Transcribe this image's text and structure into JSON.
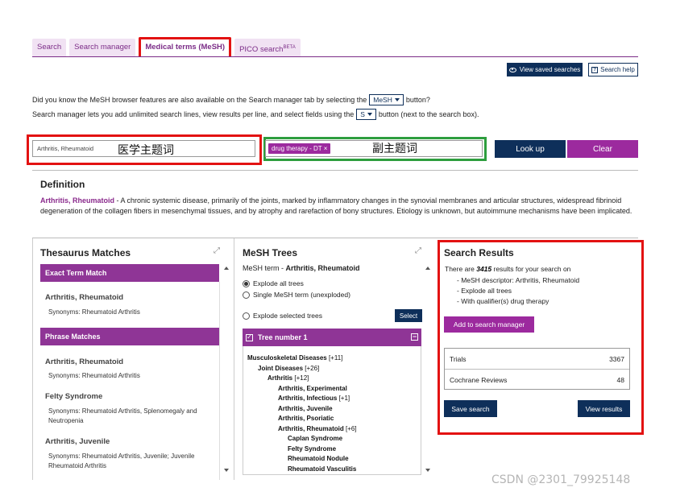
{
  "tabs": [
    {
      "label": "Search",
      "active": false
    },
    {
      "label": "Search manager",
      "active": false
    },
    {
      "label": "Medical terms (MeSH)",
      "active": true
    },
    {
      "label": "PICO search",
      "sup": "BETA",
      "active": false
    }
  ],
  "top_buttons": {
    "view_saved": "View saved searches",
    "search_help": "Search help"
  },
  "info": {
    "line1_pre": "Did you know the MeSH browser features are also available on the Search manager tab by selecting the",
    "line1_btn": "MeSH",
    "line1_post": "button?",
    "line2_pre": "Search manager lets you add unlimited search lines, view results per line, and select fields using the",
    "line2_btn": "S",
    "line2_post": "button (next to the search box)."
  },
  "search": {
    "main_term_value": "Arthritis, Rheumatoid",
    "main_term_annotation": "医学主题词",
    "qualifier_chip": "drug therapy - DT",
    "qualifier_chip_remove": "×",
    "qualifier_annotation": "副主题词",
    "lookup_label": "Look up",
    "clear_label": "Clear"
  },
  "definition": {
    "heading": "Definition",
    "term": "Arthritis, Rheumatoid",
    "text": " - A chronic systemic disease, primarily of the joints, marked by inflammatory changes in the synovial membranes and articular structures, widespread fibrinoid degeneration of the collagen fibers in mesenchymal tissues, and by atrophy and rarefaction of bony structures. Etiology is unknown, but autoimmune mechanisms have been implicated."
  },
  "thesaurus": {
    "title": "Thesaurus Matches",
    "exact_header": "Exact Term Match",
    "exact_items": [
      {
        "term": "Arthritis, Rheumatoid",
        "synonyms": "Synonyms: Rheumatoid Arthritis"
      }
    ],
    "phrase_header": "Phrase Matches",
    "phrase_items": [
      {
        "term": "Arthritis, Rheumatoid",
        "synonyms": "Synonyms: Rheumatoid Arthritis"
      },
      {
        "term": "Felty Syndrome",
        "synonyms": "Synonyms: Rheumatoid Arthritis, Splenomegaly and Neutropenia"
      },
      {
        "term": "Arthritis, Juvenile",
        "synonyms": "Synonyms: Rheumatoid Arthritis, Juvenile; Juvenile Rheumatoid Arthritis"
      }
    ]
  },
  "mesh": {
    "title": "MeSH Trees",
    "term_prefix": "MeSH term - ",
    "term": "Arthritis, Rheumatoid",
    "options": [
      {
        "label": "Explode all trees",
        "selected": true
      },
      {
        "label": "Single MeSH term (unexploded)",
        "selected": false
      },
      {
        "label": "Explode selected trees",
        "selected": false
      }
    ],
    "select_label": "Select",
    "tree_header": "Tree number 1",
    "tree_checkbox_mark": "✓",
    "tree_collapse_mark": "−",
    "nodes": [
      {
        "label": "Musculoskeletal Diseases",
        "count": "[+11]",
        "level": 0
      },
      {
        "label": "Joint Diseases",
        "count": "[+26]",
        "level": 1
      },
      {
        "label": "Arthritis",
        "count": "[+12]",
        "level": 2
      },
      {
        "label": "Arthritis, Experimental",
        "count": "",
        "level": 3
      },
      {
        "label": "Arthritis, Infectious",
        "count": "[+1]",
        "level": 3
      },
      {
        "label": "Arthritis, Juvenile",
        "count": "",
        "level": 3
      },
      {
        "label": "Arthritis, Psoriatic",
        "count": "",
        "level": 3
      },
      {
        "label": "Arthritis, Rheumatoid",
        "count": "[+6]",
        "level": 3
      },
      {
        "label": "Caplan Syndrome",
        "count": "",
        "level": 4
      },
      {
        "label": "Felty Syndrome",
        "count": "",
        "level": 4
      },
      {
        "label": "Rheumatoid Nodule",
        "count": "",
        "level": 4
      },
      {
        "label": "Rheumatoid Vasculitis",
        "count": "",
        "level": 4
      }
    ]
  },
  "results": {
    "title": "Search Results",
    "count_pre": "There are ",
    "count": "3415",
    "count_post": " results for your search on",
    "details": [
      "- MeSH descriptor: Arthritis, Rheumatoid",
      "- Explode all trees",
      "- With qualifier(s) drug therapy"
    ],
    "add_label": "Add to search manager",
    "table": [
      {
        "label": "Trials",
        "value": "3367"
      },
      {
        "label": "Cochrane Reviews",
        "value": "48"
      }
    ],
    "save_label": "Save search",
    "view_label": "View results"
  },
  "expand_glyph": "⤢",
  "watermark": "CSDN @2301_79925148",
  "colors": {
    "purple": "#8f3596",
    "navy": "#0e2f5a",
    "highlight_red": "#e31212",
    "highlight_green": "#2e9e3e"
  }
}
